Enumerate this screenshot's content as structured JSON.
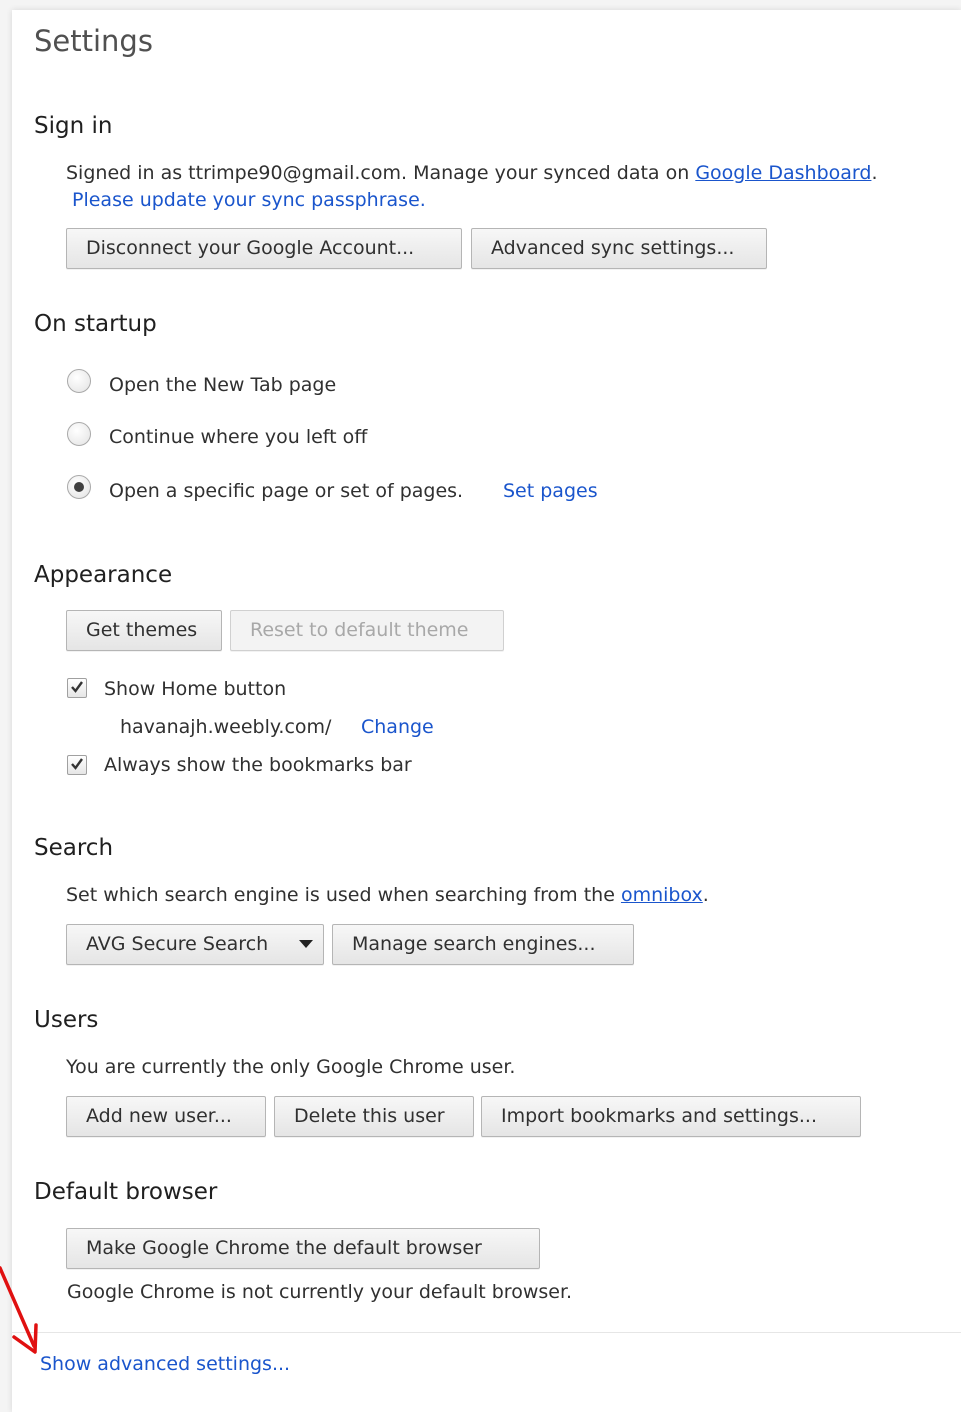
{
  "page_title": "Settings",
  "sign_in": {
    "title": "Sign in",
    "signed_in_text": "Signed in as ttrimpe90@gmail.com. Manage your synced data on",
    "dashboard_link": "Google Dashboard",
    "period": ".",
    "passphrase_link": "Please update your sync passphrase.",
    "disconnect_button": "Disconnect your Google Account...",
    "advanced_sync_button": "Advanced sync settings..."
  },
  "on_startup": {
    "title": "On startup",
    "options": [
      {
        "label": "Open the New Tab page",
        "selected": false
      },
      {
        "label": "Continue where you left off",
        "selected": false
      },
      {
        "label": "Open a specific page or set of pages.",
        "selected": true
      }
    ],
    "set_pages_link": "Set pages"
  },
  "appearance": {
    "title": "Appearance",
    "get_themes_button": "Get themes",
    "reset_theme_button": "Reset to default theme",
    "show_home_label": "Show Home button",
    "show_home_checked": true,
    "home_url": "havanajh.weebly.com/",
    "change_link": "Change",
    "bookmarks_label": "Always show the bookmarks bar",
    "bookmarks_checked": true
  },
  "search": {
    "title": "Search",
    "description": "Set which search engine is used when searching from the",
    "omnibox_link": "omnibox",
    "period": ".",
    "engine_selected": "AVG Secure Search",
    "manage_button": "Manage search engines..."
  },
  "users": {
    "title": "Users",
    "description": "You are currently the only Google Chrome user.",
    "add_button": "Add new user...",
    "delete_button": "Delete this user",
    "import_button": "Import bookmarks and settings..."
  },
  "default_browser": {
    "title": "Default browser",
    "make_default_button": "Make Google Chrome the default browser",
    "status": "Google Chrome is not currently your default browser."
  },
  "footer": {
    "advanced_link": "Show advanced settings..."
  },
  "colors": {
    "link": "#1a55cc",
    "annotation_arrow": "#e01010"
  }
}
